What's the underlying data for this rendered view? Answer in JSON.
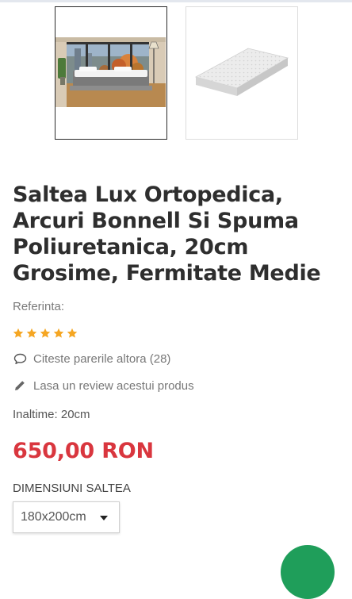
{
  "product": {
    "title": "Saltea Lux Ortopedica, Arcuri Bonnell Si Spuma Poliuretanica, 20cm Grosime, Fermitate Medie",
    "reference_label": "Referinta:",
    "rating": 5,
    "rating_max": 5,
    "reviews_link": "Citeste parerile altora (28)",
    "write_review_link": "Lasa un review acestui produs",
    "height_info": "Inaltime: 20cm",
    "price": "650,00 RON",
    "size_label": "DIMENSIUNI SALTEA",
    "size_selected": "180x200cm"
  },
  "colors": {
    "price": "#d9363e",
    "star": "#f5a623",
    "chat_button": "#1f9e5a"
  },
  "icons": {
    "reviews": "speech-bubble-icon",
    "write_review": "pencil-icon",
    "dropdown": "caret-down-icon",
    "star": "star-icon"
  }
}
